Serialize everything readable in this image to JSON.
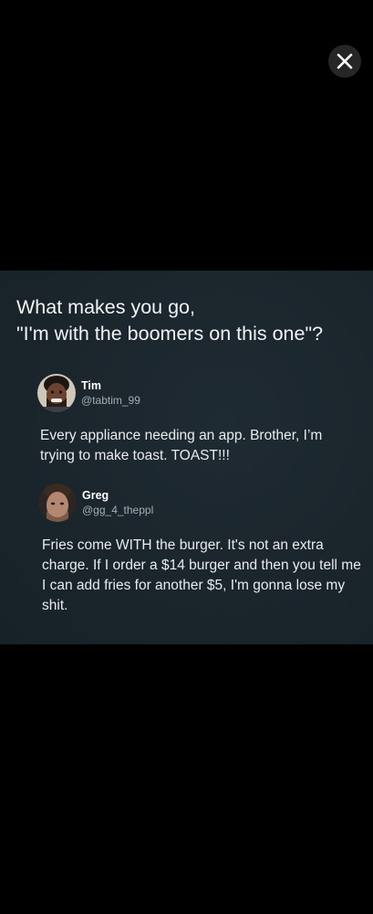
{
  "viewer": {
    "close_icon": "close-icon",
    "background_color": "#000000"
  },
  "post": {
    "headline": "What makes you go,\n\"I'm with the boomers on this one\"?",
    "background_color": "#1b262d",
    "tweets": [
      {
        "name": "Tim",
        "handle": "@tabtim_99",
        "avatar_icon": "avatar-tim",
        "text": "Every appliance needing an app. Brother, I’m trying to make toast. TOAST!!!"
      },
      {
        "name": "Greg",
        "handle": "@gg_4_theppl",
        "avatar_icon": "avatar-greg",
        "text": "Fries come WITH the burger. It's not an extra charge. If I order a $14 burger and then you tell me I can add fries for another $5, I'm gonna lose my shit."
      }
    ]
  }
}
